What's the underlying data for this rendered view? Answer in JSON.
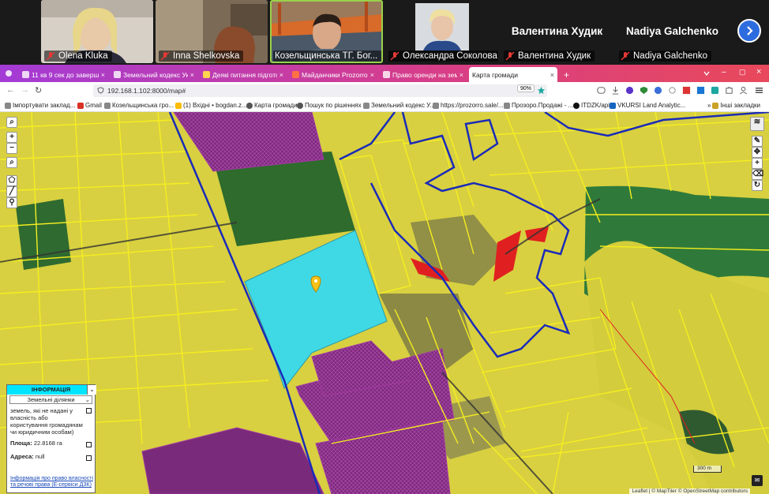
{
  "call": {
    "participants": [
      {
        "name": "Olena Kluka",
        "muted": true,
        "video": true
      },
      {
        "name": "Inna Shelkovska",
        "muted": true,
        "video": true
      },
      {
        "name": "Козельщинська ТГ. Бог...",
        "muted": false,
        "video": true,
        "active": true
      },
      {
        "name": "Олександра Соколова",
        "muted": true,
        "video": true
      },
      {
        "name": "Валентина Худик",
        "muted": true,
        "video": false,
        "display": "Валентина Худик"
      },
      {
        "name": "Nadiya Galchenko",
        "muted": true,
        "video": false,
        "display": "Nadiya Galchenko"
      }
    ],
    "next_icon": "chevron-right-icon"
  },
  "browser": {
    "tabs": [
      {
        "label": "11 кв 9 сек до завершенн"
      },
      {
        "label": "Земельний кодекс Украї"
      },
      {
        "label": "Деякі питання підготовк"
      },
      {
        "label": "Майданчики Prozorro.Пр"
      },
      {
        "label": "Право оренди на земель"
      },
      {
        "label": "Карта громади",
        "active": true
      }
    ],
    "new_tab": "+",
    "url": "192.168.1.102:8000/map#",
    "zoom": "90%",
    "bookmarks": [
      "Імпортувати заклад...",
      "Gmail",
      "Козельщинська гро...",
      "(1) Вхідні • bogdan.z...",
      "Карта громади",
      "Пошук по рішеннях",
      "Земельний кодекс У...",
      "https://prozorro.sale/...",
      "Прозоро.Продажі - ...",
      "ITDZK/api",
      "VKURSI Land Analytic...",
      "Інші закладки"
    ]
  },
  "map": {
    "controls_left": [
      "search-icon",
      "zoom-in-icon",
      "zoom-out-icon",
      "search-icon",
      "draw-polygon-icon",
      "draw-line-icon",
      "marker-icon"
    ],
    "zoom_in": "+",
    "zoom_out": "−",
    "scale": "300 m",
    "attribution": "Leaflet | © MapTiler © OpenStreetMap contributors",
    "info": {
      "header": "ІНФОРМАЦІЯ",
      "layer": "Земельні ділянки",
      "purpose": "земель, які не надані у власність або користування громадянам чи юридичним особам)",
      "area_label": "Площа:",
      "area_value": "22.8168 га",
      "address_label": "Адреса:",
      "address_value": "null",
      "link": "Інформація про право власності та речові права (Е-сервіси ДЗК)"
    },
    "colors": {
      "parcel_fill": "#e6dc3a",
      "parcel_stroke": "#f5ee20",
      "boundary": "#1a2bb8",
      "selected": "#3fd9e6",
      "purple": "#8a2a86",
      "red": "#e02020"
    }
  }
}
